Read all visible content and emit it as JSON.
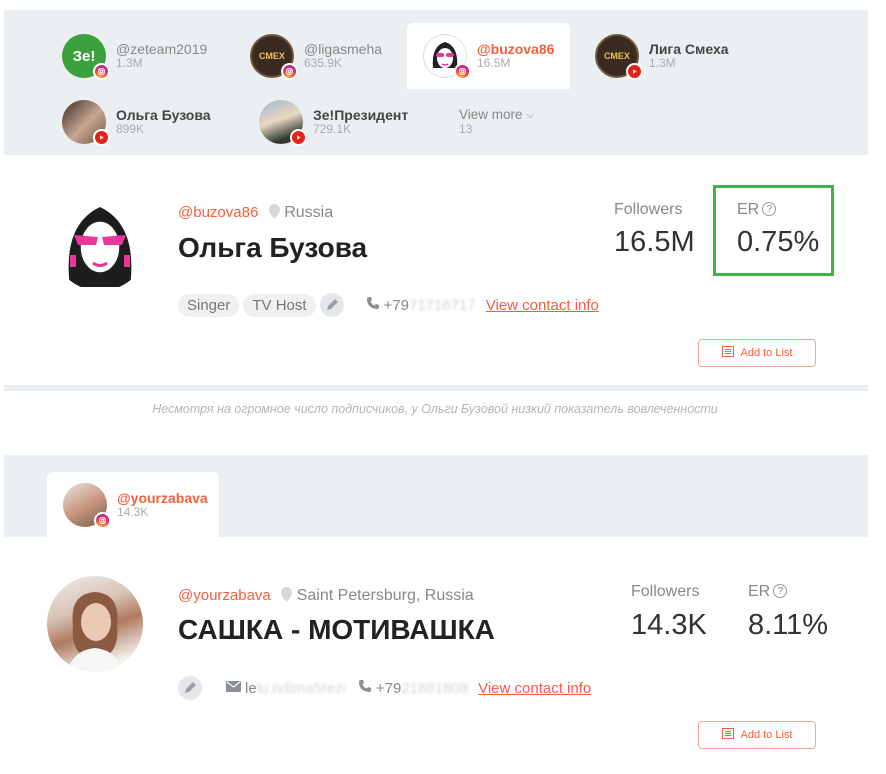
{
  "section1": {
    "accounts": [
      {
        "name": "@zeteam2019",
        "count": "1.3M",
        "platform": "instagram",
        "avatar_text": "Зе!"
      },
      {
        "name": "@ligasmeha",
        "count": "635.9K",
        "platform": "instagram",
        "avatar_text": "СМЕХ"
      },
      {
        "name": "@buzova86",
        "count": "16.5M",
        "platform": "instagram",
        "active": true
      },
      {
        "name": "Лига Смеха",
        "count": "1.3M",
        "platform": "youtube",
        "avatar_text": "СМЕХ"
      },
      {
        "name": "Ольга Бузова",
        "count": "899K",
        "platform": "youtube"
      },
      {
        "name": "Зе!Президент",
        "count": "729.1K",
        "platform": "youtube"
      }
    ],
    "view_more": {
      "label": "View more",
      "count": "13"
    },
    "profile": {
      "handle": "@buzova86",
      "location": "Russia",
      "name": "Ольга Бузова",
      "tags": [
        "Singer",
        "TV Host"
      ],
      "phone_prefix": "+79",
      "phone_hidden": "71716717",
      "contact_link": "View contact info",
      "followers_label": "Followers",
      "followers_value": "16.5M",
      "er_label": "ER",
      "er_value": "0.75%",
      "add_button": "Add to List"
    }
  },
  "caption": "Несмотря на огромное число подписчиков, у Ольги Бузовой низкий показатель вовлеченности",
  "section2": {
    "account": {
      "name": "@yourzabava",
      "count": "14.3K",
      "platform": "instagram"
    },
    "profile": {
      "handle": "@yourzabava",
      "location": "Saint Petersburg, Russia",
      "name": "САШКА - МОТИВАШКА",
      "email_prefix": "le",
      "email_hidden": "lu.ndima5rezi",
      "phone_prefix": "+79",
      "phone_hidden": "21881808",
      "contact_link": "View contact info",
      "followers_label": "Followers",
      "followers_value": "14.3K",
      "er_label": "ER",
      "er_value": "8.11%",
      "add_button": "Add to List"
    }
  },
  "colors": {
    "accent": "#f0613e",
    "highlight": "#3bb54a",
    "panel": "#eceff1"
  },
  "icons": {
    "help": "?",
    "chevron": "⌄"
  }
}
